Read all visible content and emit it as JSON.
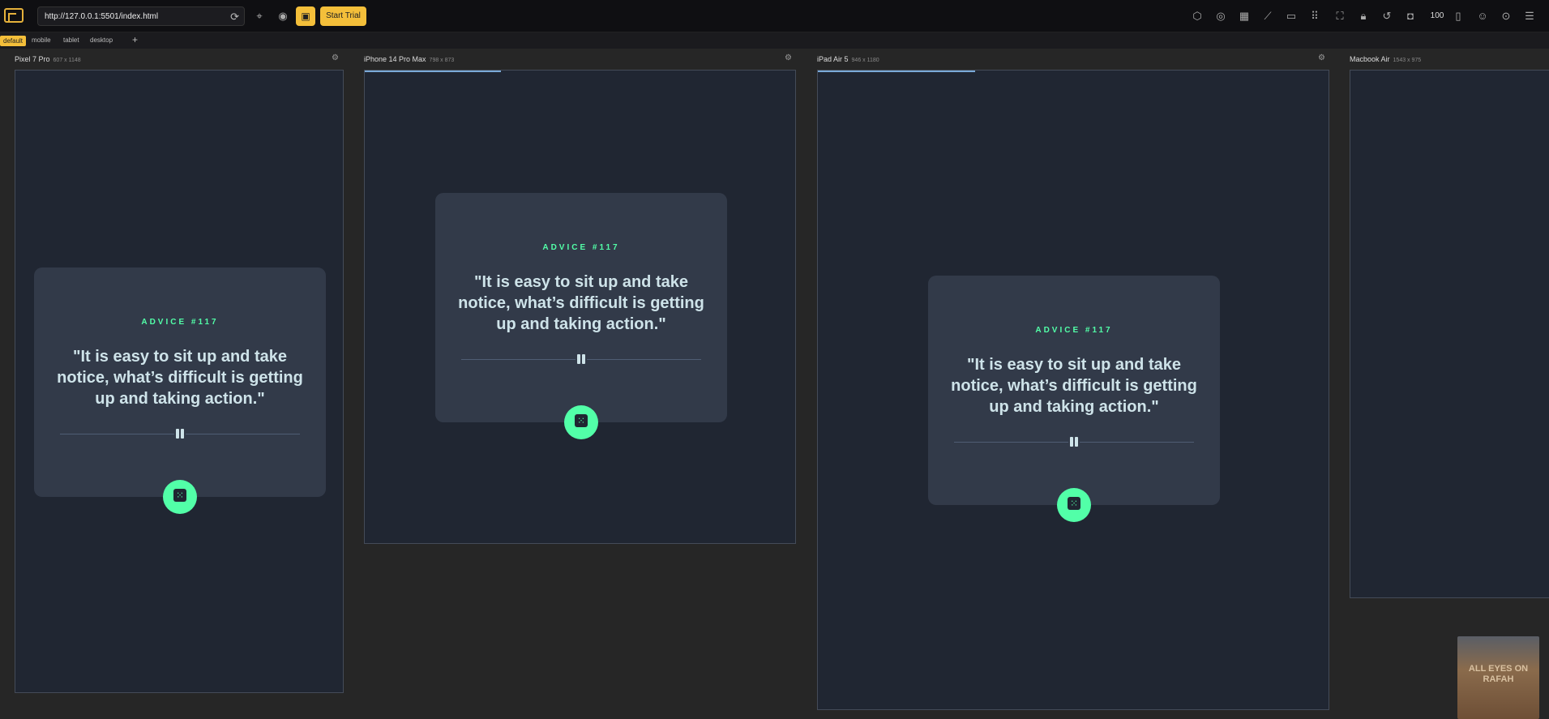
{
  "browser": {
    "url": "http://127.0.0.1:5501/index.html",
    "start_trial_label": "Start Trial",
    "zoom": "100"
  },
  "tabs": [
    "default",
    "mobile",
    "tablet",
    "desktop"
  ],
  "add_tab_label": "+",
  "devices": [
    {
      "name": "Pixel 7 Pro",
      "dims": "607 x 1148"
    },
    {
      "name": "iPhone 14 Pro Max",
      "dims": "798 x 873"
    },
    {
      "name": "iPad Air 5",
      "dims": "946 x 1180"
    },
    {
      "name": "Macbook Air",
      "dims": "1543 x 975"
    }
  ],
  "advice": {
    "number": "ADVICE #117",
    "quote": "\"It is easy to sit up and take notice, what’s difficult is getting up and taking action.\""
  },
  "thumbnail": {
    "text": "ALL EYES ON RAFAH"
  },
  "colors": {
    "accent": "#f4bf3a",
    "neon_green": "#52ffa8",
    "card_bg": "#323a49",
    "frame_bg": "#202632"
  }
}
